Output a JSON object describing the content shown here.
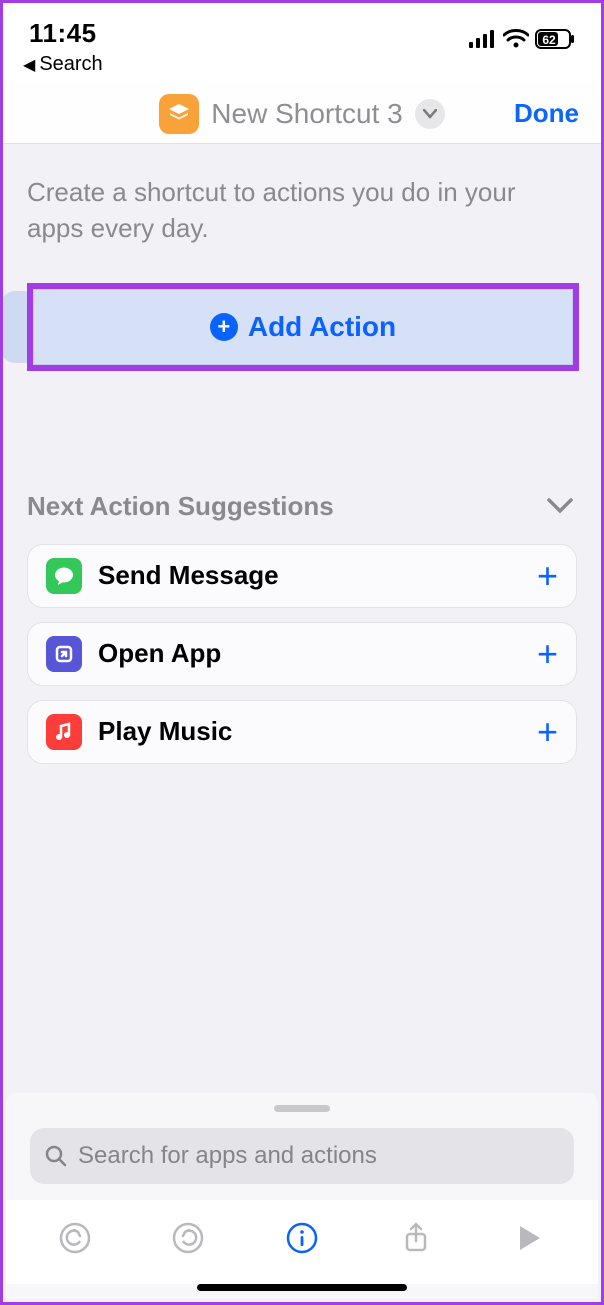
{
  "status": {
    "time": "11:45",
    "battery": "62"
  },
  "back": {
    "label": "Search"
  },
  "nav": {
    "title": "New Shortcut 3",
    "done": "Done"
  },
  "main": {
    "help": "Create a shortcut to actions you do in your apps every day.",
    "add_label": "Add Action",
    "suggestions_title": "Next Action Suggestions"
  },
  "suggestions": [
    {
      "label": "Send Message",
      "icon": "messages",
      "color": "green"
    },
    {
      "label": "Open App",
      "icon": "open-app",
      "color": "purple"
    },
    {
      "label": "Play Music",
      "icon": "music",
      "color": "red"
    }
  ],
  "search": {
    "placeholder": "Search for apps and actions"
  }
}
